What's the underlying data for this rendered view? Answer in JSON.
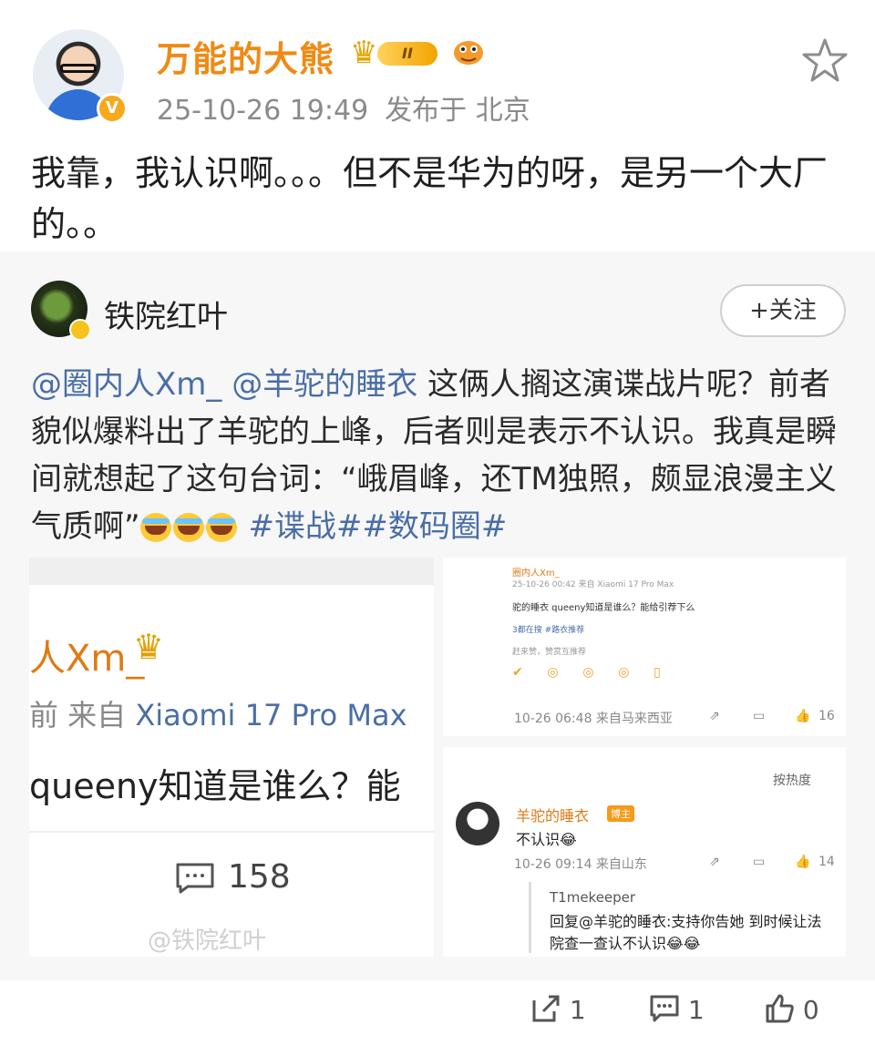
{
  "post": {
    "author": "万能的大熊",
    "vip_level": "II",
    "time": "25-10-26 19:49",
    "location": "发布于 北京",
    "text": "我靠，我认识啊。。。但不是华为的呀，是另一个大厂的。。"
  },
  "repost": {
    "author": "铁院红叶",
    "follow_label": "+关注",
    "text_mention1": "@圈内人Xm_",
    "text_mention2": "@羊驼的睡衣",
    "text_body": " 这俩人搁这演谍战片呢？前者貌似爆料出了羊驼的上峰，后者则是表示不认识。我真是瞬间就想起了这句台词：“峨眉峰，还TM独照，颇显浪漫主义气质啊”",
    "topic1": "#谍战#",
    "topic2": "#数码圈#"
  },
  "image_left": {
    "nick": "人Xm_",
    "from_prefix": "前  来自",
    "device": "Xiaomi 17 Pro Max",
    "question": "queeny知道是谁么？能",
    "comment_count": "158",
    "watermark": "@铁院红叶"
  },
  "image_right_top": {
    "nick": "圈内人Xm_",
    "meta": "25-10-26 00:42  来自 Xiaomi 17 Pro Max",
    "text": "驼的睡衣  queeny知道是谁么？能给引荐下么",
    "tags": "3都在搜  #路衣推荐",
    "hint": "赶来赞，赞赏互推荐",
    "time_loc": "10-26 06:48  来自马来西亚",
    "likes": "16"
  },
  "image_right_bottom": {
    "sort": "按热度",
    "name": "羊驼的睡衣",
    "tag": "博主",
    "text": "不认识😂",
    "time_loc": "10-26 09:14  来自山东",
    "likes": "14",
    "reply_name": "T1mekeeper",
    "reply_text": "回复@羊驼的睡衣:支持你告她 到时候让法院查一查认不认识😂😂"
  },
  "footer": {
    "repost_count": "1",
    "comment_count": "1",
    "like_count": "0"
  }
}
